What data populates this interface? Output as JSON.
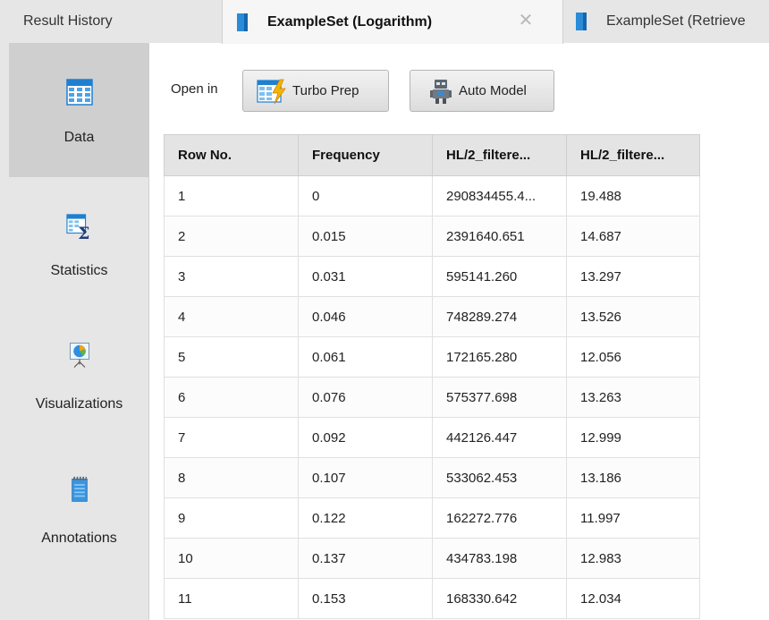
{
  "tabs": {
    "history_label": "Result History",
    "active_label": "ExampleSet (Logarithm)",
    "other_label": "ExampleSet (Retrieve",
    "close_symbol": "✕"
  },
  "sidebar": {
    "items": [
      {
        "label": "Data",
        "icon": "table-grid-icon"
      },
      {
        "label": "Statistics",
        "icon": "statistics-sigma-icon"
      },
      {
        "label": "Visualizations",
        "icon": "pie-chart-easel-icon"
      },
      {
        "label": "Annotations",
        "icon": "notepad-icon"
      }
    ]
  },
  "toolbar": {
    "open_in_label": "Open in",
    "turbo_prep_label": "Turbo Prep",
    "auto_model_label": "Auto Model"
  },
  "table": {
    "columns": [
      "Row No.",
      "Frequency",
      "HL/2_filtere...",
      "HL/2_filtere..."
    ],
    "rows": [
      [
        "1",
        "0",
        "290834455.4...",
        "19.488"
      ],
      [
        "2",
        "0.015",
        "2391640.651",
        "14.687"
      ],
      [
        "3",
        "0.031",
        "595141.260",
        "13.297"
      ],
      [
        "4",
        "0.046",
        "748289.274",
        "13.526"
      ],
      [
        "5",
        "0.061",
        "172165.280",
        "12.056"
      ],
      [
        "6",
        "0.076",
        "575377.698",
        "13.263"
      ],
      [
        "7",
        "0.092",
        "442126.447",
        "12.999"
      ],
      [
        "8",
        "0.107",
        "533062.453",
        "13.186"
      ],
      [
        "9",
        "0.122",
        "162272.776",
        "11.997"
      ],
      [
        "10",
        "0.137",
        "434783.198",
        "12.983"
      ],
      [
        "11",
        "0.153",
        "168330.642",
        "12.034"
      ]
    ]
  },
  "colors": {
    "accent_blue": "#2a8bd8",
    "sidebar_bg": "#e6e6e6",
    "sidebar_active_bg": "#cfcfcf",
    "header_bg": "#e4e4e4"
  }
}
